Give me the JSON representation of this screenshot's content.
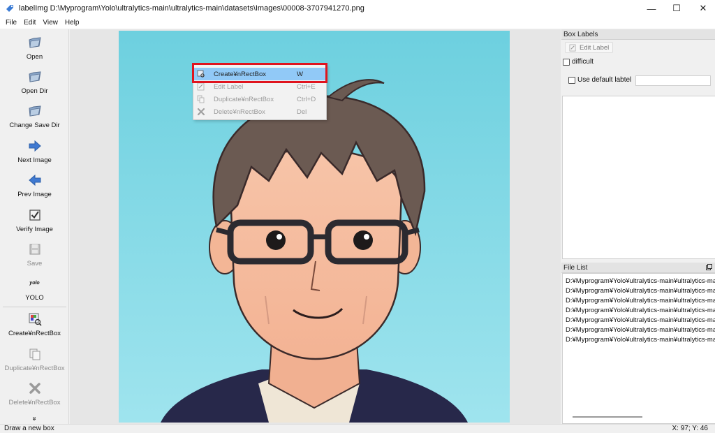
{
  "window": {
    "title": "labelImg D:\\Myprogram\\Yolo\\ultralytics-main\\ultralytics-main\\datasets\\Images\\00008-3707941270.png",
    "minimize": "—",
    "maximize": "☐",
    "close": "✕"
  },
  "menu": [
    "File",
    "Edit",
    "View",
    "Help"
  ],
  "toolbar": {
    "open": "Open",
    "open_dir": "Open Dir",
    "change_save_dir": "Change Save Dir",
    "next_image": "Next Image",
    "prev_image": "Prev Image",
    "verify_image": "Verify Image",
    "save": "Save",
    "format_icon_text": "yolo",
    "format": "YOLO",
    "create_rect": "Create¥nRectBox",
    "duplicate_rect": "Duplicate¥nRectBox",
    "delete_rect": "Delete¥nRectBox",
    "more": "»"
  },
  "context_menu": [
    {
      "label": "Create¥nRectBox",
      "shortcut": "W",
      "state": "active"
    },
    {
      "label": "Edit Label",
      "shortcut": "Ctrl+E",
      "state": "disabled"
    },
    {
      "label": "Duplicate¥nRectBox",
      "shortcut": "Ctrl+D",
      "state": "disabled"
    },
    {
      "label": "Delete¥nRectBox",
      "shortcut": "Del",
      "state": "disabled"
    }
  ],
  "box_labels": {
    "title": "Box Labels",
    "edit_label": "Edit Label",
    "difficult": "difficult",
    "use_default": "Use default labtel",
    "default_value": ""
  },
  "file_list": {
    "title": "File List",
    "items": [
      "D:¥Myprogram¥Yolo¥ultralytics-main¥ultralytics-main",
      "D:¥Myprogram¥Yolo¥ultralytics-main¥ultralytics-main",
      "D:¥Myprogram¥Yolo¥ultralytics-main¥ultralytics-main",
      "D:¥Myprogram¥Yolo¥ultralytics-main¥ultralytics-main",
      "D:¥Myprogram¥Yolo¥ultralytics-main¥ultralytics-main",
      "D:¥Myprogram¥Yolo¥ultralytics-main¥ultralytics-main",
      "D:¥Myprogram¥Yolo¥ultralytics-main¥ultralytics-main"
    ]
  },
  "status": {
    "message": "Draw a new box",
    "position": "X: 97; Y: 46"
  },
  "colors": {
    "highlight_border": "#e0141e",
    "menu_active": "#91c9f7",
    "image_bg": "#74d2e0"
  }
}
